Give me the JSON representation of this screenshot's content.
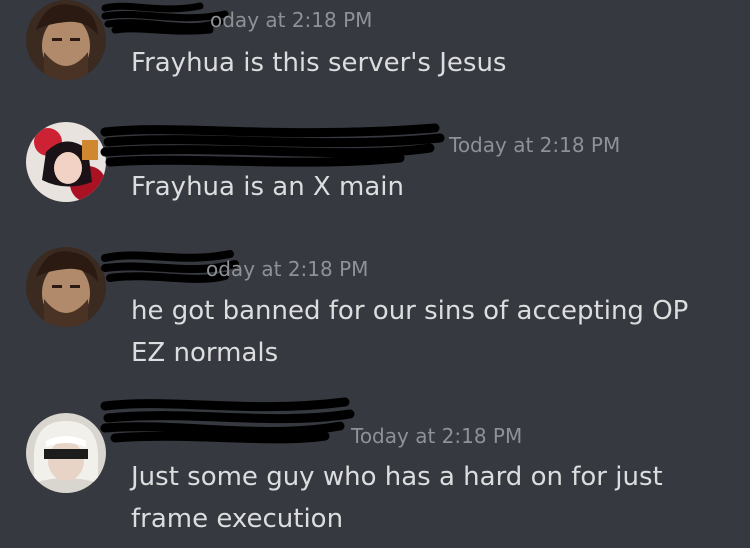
{
  "messages": [
    {
      "avatar": "avatar-bearded-man",
      "timestamp": "oday at 2:18 PM",
      "lines": [
        "Frayhua is this server's Jesus"
      ]
    },
    {
      "avatar": "avatar-anime-girl-red",
      "timestamp": "Today at 2:18 PM",
      "lines": [
        "Frayhua is an X main"
      ]
    },
    {
      "avatar": "avatar-bearded-man",
      "timestamp": "oday at 2:18 PM",
      "lines": [
        "he got banned for our sins of accepting OP",
        "EZ normals"
      ]
    },
    {
      "avatar": "avatar-white-hair-blindfold",
      "timestamp": "Today at 2:18 PM",
      "lines": [
        "Just some guy who has a hard on for just",
        "frame execution"
      ]
    }
  ],
  "colors": {
    "background": "#36393f",
    "text": "#dcddde",
    "timestamp": "#8e9297",
    "redaction": "#000000"
  }
}
